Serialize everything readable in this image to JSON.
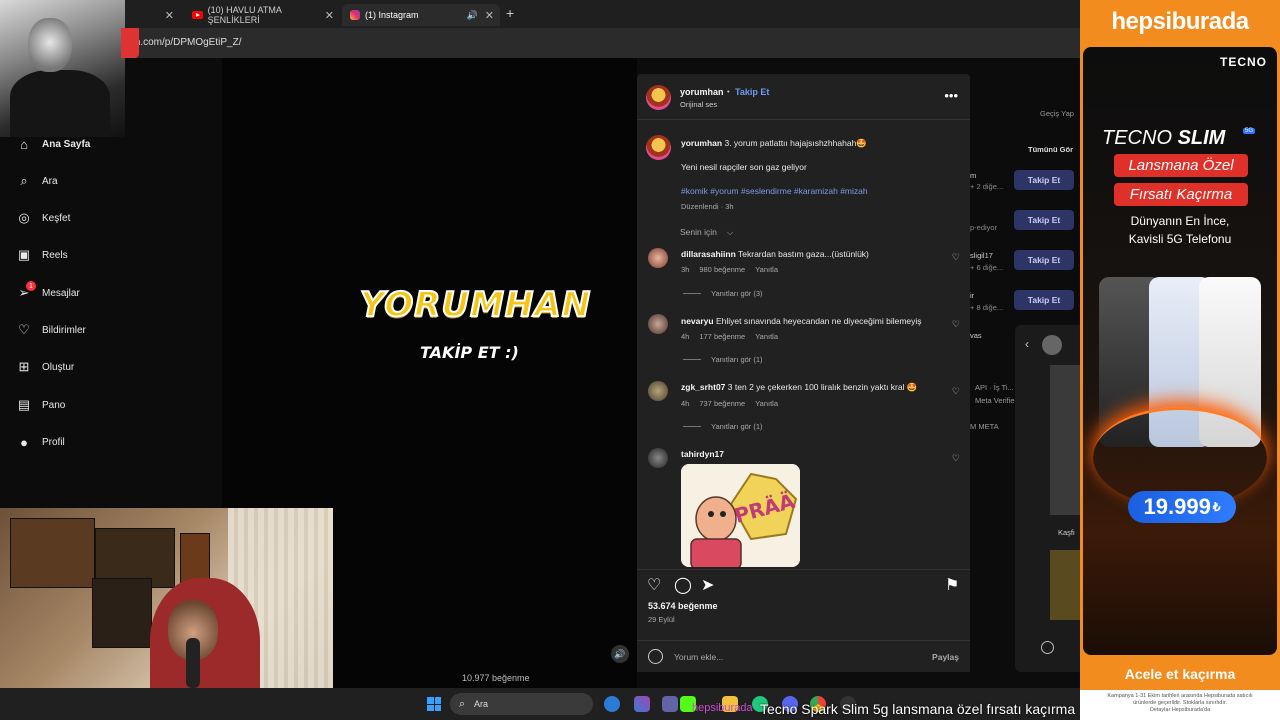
{
  "browser": {
    "tabs": [
      {
        "label": "(10) HAVLU ATMA ŞENLİKLERİ"
      },
      {
        "label": "(1) Instagram"
      }
    ],
    "url": "m.com/p/DPMOgEtiP_Z/"
  },
  "sidebar": {
    "items": [
      {
        "label": "Ana Sayfa",
        "icon": "home-icon"
      },
      {
        "label": "Ara",
        "icon": "search-icon"
      },
      {
        "label": "Keşfet",
        "icon": "compass-icon"
      },
      {
        "label": "Reels",
        "icon": "reels-icon"
      },
      {
        "label": "Mesajlar",
        "icon": "messenger-icon",
        "badge": "1"
      },
      {
        "label": "Bildirimler",
        "icon": "heart-icon"
      },
      {
        "label": "Oluştur",
        "icon": "plus-square-icon"
      },
      {
        "label": "Pano",
        "icon": "chart-icon"
      },
      {
        "label": "Profil",
        "icon": "profile-icon"
      }
    ]
  },
  "video": {
    "logo_text": "YORUMHAN",
    "overlay_text": "TAKİP ET :)",
    "likes_caption": "10.977 beğenme"
  },
  "post": {
    "username": "yorumhan",
    "follow_label": "Takip Et",
    "audio": "Orijinal ses",
    "caption_user": "yorumhan",
    "caption": "3. yorum patlattıı hajajsıshzhhahah🤩",
    "caption_line2": "Yeni nesil rapçiler son gaz geliyor",
    "hashtags": "#komik #yorum #seslendirme #karamizah #mizah",
    "edited": "Düzenlendi · 3h",
    "sort_label": "Senin için",
    "comments": [
      {
        "user": "dillarasahiinn",
        "text": "Tekrardan bastım gaza...(üstünlük)",
        "time": "3h",
        "likes": "980 beğenme",
        "reply": "Yanıtla",
        "view_replies": "Yanıtları gör (3)"
      },
      {
        "user": "nevaryu",
        "text": "Ehliyet sınavında heyecandan ne diyeceğimi bilemeyiş",
        "time": "4h",
        "likes": "177 beğenme",
        "reply": "Yanıtla",
        "view_replies": "Yanıtları gör (1)"
      },
      {
        "user": "zgk_srht07",
        "text": "3 ten 2 ye çekerken 100 liralık benzin yaktı kral 🤩",
        "time": "4h",
        "likes": "737 beğenme",
        "reply": "Yanıtla",
        "view_replies": "Yanıtları gör (1)"
      },
      {
        "user": "tahirdyn17",
        "text": "",
        "sticker": "PRÄÄ"
      }
    ],
    "like_count": "53.674 beğenme",
    "date": "29 Eylül",
    "comment_placeholder": "Yorum ekle...",
    "share_label": "Paylaş"
  },
  "suggestions": {
    "switch_label": "Geçiş Yap",
    "see_all": "Tümünü Gör",
    "follow_label": "Takip Et",
    "names": [
      "m",
      "p-ediyor",
      "sligil17",
      "ir",
      "vas"
    ],
    "sub": [
      "+ 2 diğe...",
      "+ 6 diğe...",
      "+ 8 diğe..."
    ],
    "footer": [
      "API · İş Ti...",
      "Meta Verifie...",
      "M META"
    ],
    "mini_label": "Kaşfi"
  },
  "taskbar": {
    "search": "Ara",
    "ticker_prefix": "hepsiburada",
    "ticker": "Tecno Spark Slim 5g lansmana özel fırsatı kaçırma"
  },
  "ad": {
    "logo": "hepsiburada",
    "brand": "TECNO",
    "title_a": "TECNO",
    "title_b": "SLIM",
    "badge_5g": "5G",
    "pill1": "Lansmana Özel",
    "pill2": "Fırsatı Kaçırma",
    "sub1": "Dünyanın En İnce,",
    "sub2": "Kavisli 5G Telefonu",
    "price": "19.999",
    "currency": "₺",
    "cta": "Acele et kaçırma",
    "fine1": "Kampanya 1-31 Ekim tarihleri arasında Hepsiburada satıcılı",
    "fine2": "ürünlerde geçerlidir. Stoklarla sınırlıdır.",
    "fine3": "Detaylar Hepsiburada'da",
    "colors": {
      "brand_orange": "#f28c1e",
      "price_blue": "#2f7dff",
      "pill_red": "#e0302a"
    }
  }
}
